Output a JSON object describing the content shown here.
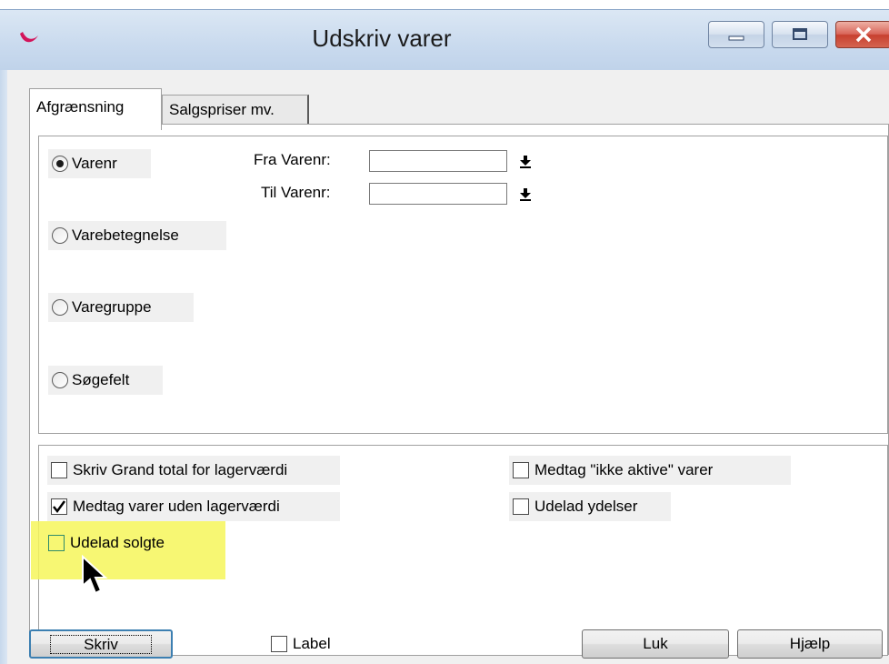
{
  "window": {
    "title": "Udskriv varer"
  },
  "tabs": [
    {
      "label": "Afgrænsning",
      "active": true
    },
    {
      "label": "Salgspriser mv.",
      "active": false
    }
  ],
  "selection": {
    "radios": [
      {
        "label": "Varenr",
        "checked": true
      },
      {
        "label": "Varebetegnelse",
        "checked": false
      },
      {
        "label": "Varegruppe",
        "checked": false
      },
      {
        "label": "Søgefelt",
        "checked": false
      }
    ],
    "fra_label": "Fra Varenr:",
    "til_label": "Til Varenr:",
    "fra_value": "",
    "til_value": ""
  },
  "options": {
    "grand_total": {
      "label": "Skriv Grand total for lagerværdi",
      "checked": false
    },
    "uden_lagervaerdi": {
      "label": "Medtag varer uden lagerværdi",
      "checked": true
    },
    "udelad_solgte": {
      "label": "Udelad solgte",
      "checked": false
    },
    "ikke_aktive": {
      "label": "Medtag \"ikke aktive\" varer",
      "checked": false
    },
    "udelad_ydelser": {
      "label": "Udelad ydelser",
      "checked": false
    }
  },
  "footer": {
    "skriv": "Skriv",
    "label_checkbox": "Label",
    "luk": "Luk",
    "hjaelp": "Hjælp"
  },
  "colors": {
    "highlight": "#f6f65a",
    "titlebar": "#c9daee",
    "close_button": "#c7402f"
  }
}
